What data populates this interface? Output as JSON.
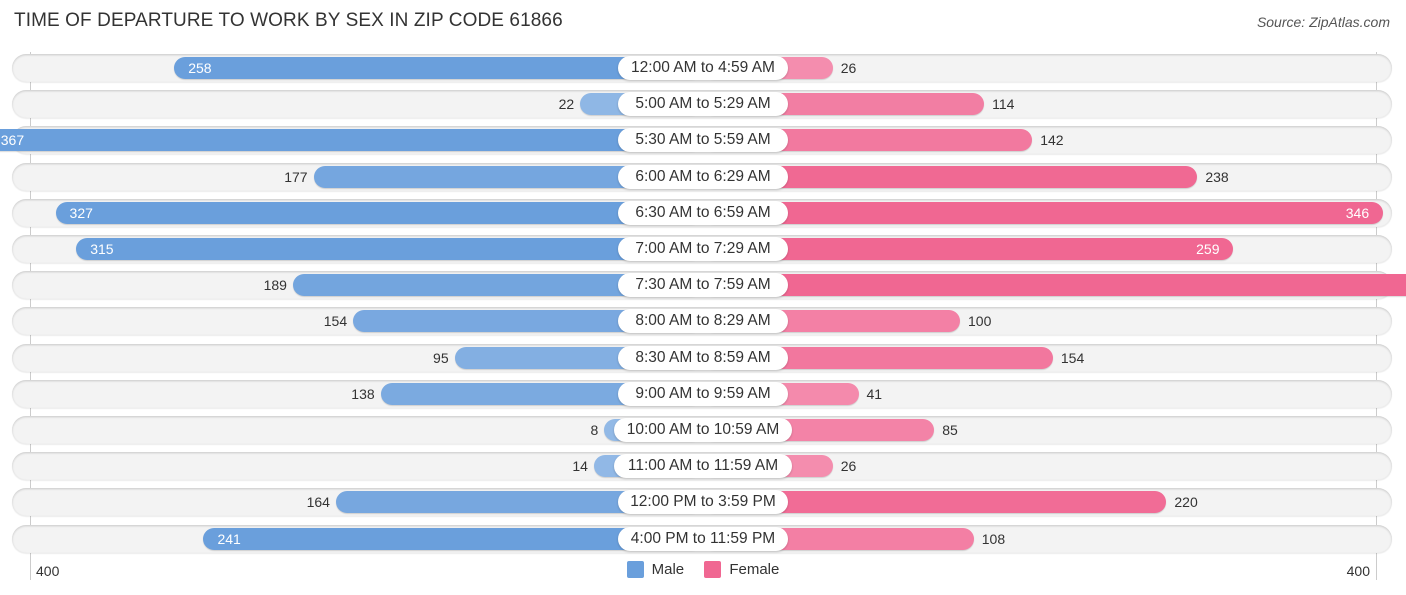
{
  "header": {
    "title": "TIME OF DEPARTURE TO WORK BY SEX IN ZIP CODE 61866",
    "source": "Source: ZipAtlas.com"
  },
  "colors": {
    "male": "#6a9fdc",
    "male_light": "#a9c8ec",
    "female": "#f06792",
    "female_light": "#f7a8c2"
  },
  "chart_data": {
    "type": "bar",
    "orientation": "horizontal-diverging",
    "title": "TIME OF DEPARTURE TO WORK BY SEX IN ZIP CODE 61866",
    "categories": [
      "12:00 AM to 4:59 AM",
      "5:00 AM to 5:29 AM",
      "5:30 AM to 5:59 AM",
      "6:00 AM to 6:29 AM",
      "6:30 AM to 6:59 AM",
      "7:00 AM to 7:29 AM",
      "7:30 AM to 7:59 AM",
      "8:00 AM to 8:29 AM",
      "8:30 AM to 8:59 AM",
      "9:00 AM to 9:59 AM",
      "10:00 AM to 10:59 AM",
      "11:00 AM to 11:59 AM",
      "12:00 PM to 3:59 PM",
      "4:00 PM to 11:59 PM"
    ],
    "series": [
      {
        "name": "Male",
        "values": [
          258,
          22,
          367,
          177,
          327,
          315,
          189,
          154,
          95,
          138,
          8,
          14,
          164,
          241
        ]
      },
      {
        "name": "Female",
        "values": [
          26,
          114,
          142,
          238,
          346,
          259,
          383,
          100,
          154,
          41,
          85,
          26,
          220,
          108
        ]
      }
    ],
    "axis": {
      "left_label": "400",
      "right_label": "400",
      "max": 400
    },
    "legend": {
      "position": "bottom-center",
      "items": [
        "Male",
        "Female"
      ]
    }
  }
}
